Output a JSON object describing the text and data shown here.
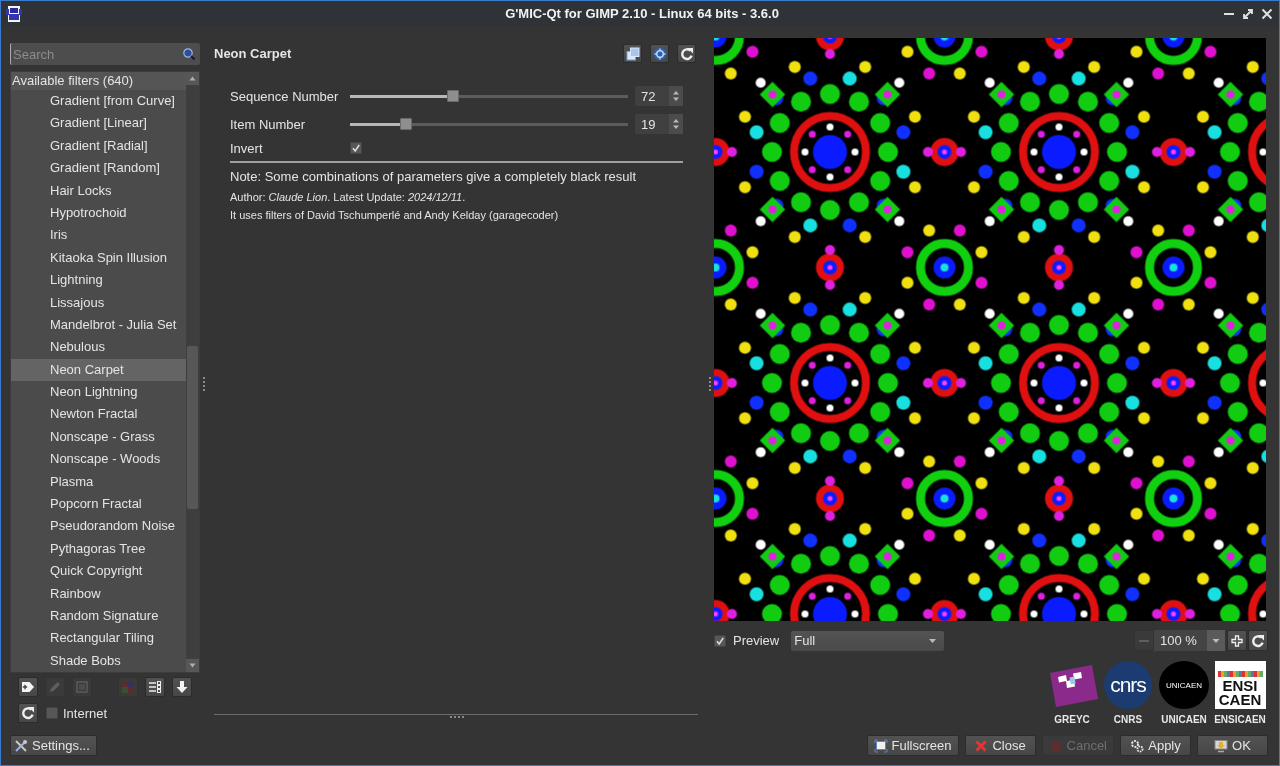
{
  "window": {
    "title": "G'MIC-Qt for GIMP 2.10 - Linux 64 bits - 3.6.0"
  },
  "filter_panel": {
    "search": {
      "placeholder": "Search"
    },
    "list_header": "Available filters (640)",
    "filters": [
      {
        "label": "Gradient [from Curve]",
        "selected": false
      },
      {
        "label": "Gradient [Linear]",
        "selected": false
      },
      {
        "label": "Gradient [Radial]",
        "selected": false
      },
      {
        "label": "Gradient [Random]",
        "selected": false
      },
      {
        "label": "Hair Locks",
        "selected": false
      },
      {
        "label": "Hypotrochoid",
        "selected": false
      },
      {
        "label": "Iris",
        "selected": false
      },
      {
        "label": "Kitaoka Spin Illusion",
        "selected": false
      },
      {
        "label": "Lightning",
        "selected": false
      },
      {
        "label": "Lissajous",
        "selected": false
      },
      {
        "label": "Mandelbrot - Julia Set",
        "selected": false
      },
      {
        "label": "Nebulous",
        "selected": false
      },
      {
        "label": "Neon Carpet",
        "selected": true
      },
      {
        "label": "Neon Lightning",
        "selected": false
      },
      {
        "label": "Newton Fractal",
        "selected": false
      },
      {
        "label": "Nonscape - Grass",
        "selected": false
      },
      {
        "label": "Nonscape - Woods",
        "selected": false
      },
      {
        "label": "Plasma",
        "selected": false
      },
      {
        "label": "Popcorn Fractal",
        "selected": false
      },
      {
        "label": "Pseudorandom Noise",
        "selected": false
      },
      {
        "label": "Pythagoras Tree",
        "selected": false
      },
      {
        "label": "Quick Copyright",
        "selected": false
      },
      {
        "label": "Rainbow",
        "selected": false
      },
      {
        "label": "Random Signature",
        "selected": false
      },
      {
        "label": "Rectangular Tiling",
        "selected": false
      },
      {
        "label": "Shade Bobs",
        "selected": false
      }
    ],
    "toolbar": [
      {
        "kind": "favorite",
        "disabled": false
      },
      {
        "kind": "rename",
        "disabled": true
      },
      {
        "kind": "remove",
        "disabled": true
      },
      {
        "kind": "colors",
        "disabled": true
      },
      {
        "kind": "visibility",
        "disabled": false
      },
      {
        "kind": "expand",
        "disabled": false
      }
    ],
    "internet": {
      "label": "Internet",
      "checked": false
    },
    "settings_button": "Settings..."
  },
  "filter": {
    "title": "Neon Carpet",
    "parameters": [
      {
        "kind": "slider",
        "label": "Sequence Number",
        "level": 0.37,
        "value": "72"
      },
      {
        "kind": "slider",
        "label": "Item Number",
        "level": 0.2,
        "value": "19"
      },
      {
        "kind": "checkbox",
        "label": "Invert",
        "checked": true
      }
    ],
    "note": "Note: Some combinations of parameters give a completely black result",
    "author_line": "Author: *Claude Lion*. Latest Update: *2024/12/11*.",
    "credits": "It uses filters of David Tschumperlé and Andy Kelday (garagecoder)"
  },
  "preview": {
    "checkbox": {
      "label": "Preview",
      "checked": true
    },
    "mode": "Full",
    "zoom": {
      "value": "100 %",
      "zoom_out_disabled": true
    }
  },
  "logos": [
    {
      "kind": "greyc",
      "label": "GREYC"
    },
    {
      "kind": "cnrs",
      "label": "CNRS",
      "logo_text": [
        "cnrs"
      ]
    },
    {
      "kind": "unicaen",
      "label": "UNICAEN",
      "logo_text": [
        "UNICAEN"
      ]
    },
    {
      "kind": "ensicaen",
      "label": "ENSICAEN",
      "logo_text": [
        "ENSI",
        "CAEN"
      ]
    }
  ],
  "buttons": [
    {
      "kind": "fullscreen",
      "label": "Fullscreen",
      "disabled": false
    },
    {
      "kind": "close",
      "label": "Close",
      "disabled": false
    },
    {
      "kind": "cancel",
      "label": "Cancel",
      "disabled": true
    },
    {
      "kind": "apply",
      "label": "Apply",
      "disabled": false
    },
    {
      "kind": "ok",
      "label": "OK",
      "disabled": false
    }
  ]
}
